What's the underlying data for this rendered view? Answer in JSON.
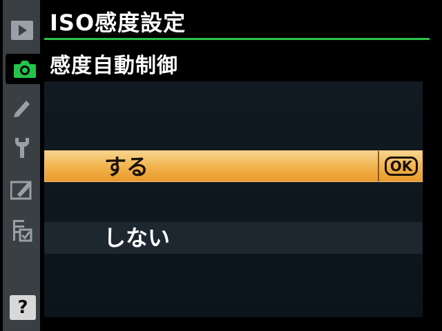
{
  "header": {
    "title": "ISO感度設定",
    "accent_color": "#29c24a"
  },
  "subtitle": "感度自動制御",
  "sidebar": {
    "items": [
      {
        "icon": "playback-icon",
        "active": false
      },
      {
        "icon": "camera-icon",
        "active": true
      },
      {
        "icon": "pencil-icon",
        "active": false
      },
      {
        "icon": "wrench-icon",
        "active": false
      },
      {
        "icon": "retouch-icon",
        "active": false
      },
      {
        "icon": "my-menu-icon",
        "active": false
      }
    ],
    "help_label": "?"
  },
  "options": [
    {
      "label": "する",
      "selected": true
    },
    {
      "label": "しない",
      "selected": false
    }
  ],
  "ok_label": "OK",
  "colors": {
    "selected_bg": "#f2b14a",
    "sidebar_bg": "#3a3f44",
    "panel_bg": "#0f171e"
  }
}
